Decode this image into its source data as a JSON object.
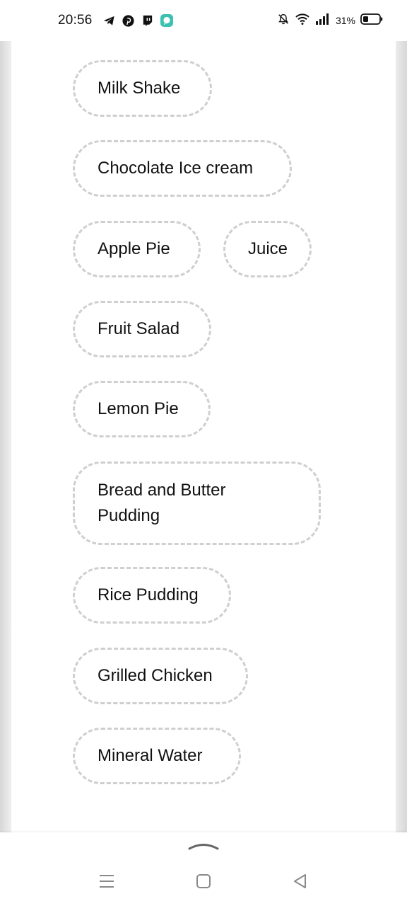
{
  "status_bar": {
    "time": "20:56",
    "app_icons": [
      "telegram-icon",
      "pinterest-icon",
      "twitch-icon",
      "chat-app-icon"
    ],
    "system_icons": [
      "bell-muted-icon",
      "wifi-icon",
      "signal-icon",
      "battery-icon"
    ],
    "battery_percent": "31%"
  },
  "menu": {
    "items": [
      {
        "label": "Milk Shake"
      },
      {
        "label": "Chocolate Ice cream"
      },
      {
        "label": "Apple Pie"
      },
      {
        "label": "Juice"
      },
      {
        "label": "Fruit Salad"
      },
      {
        "label": "Lemon Pie"
      },
      {
        "label": "Bread and Butter Pudding"
      },
      {
        "label": "Rice Pudding"
      },
      {
        "label": "Grilled Chicken"
      },
      {
        "label": "Mineral Water"
      }
    ]
  },
  "nav_bar": {
    "buttons": [
      "swipe-up-icon",
      "menu-icon",
      "home-icon",
      "back-icon"
    ]
  },
  "colors": {
    "chip_border": "#cfcfcf",
    "text": "#111111",
    "background": "#ffffff"
  }
}
